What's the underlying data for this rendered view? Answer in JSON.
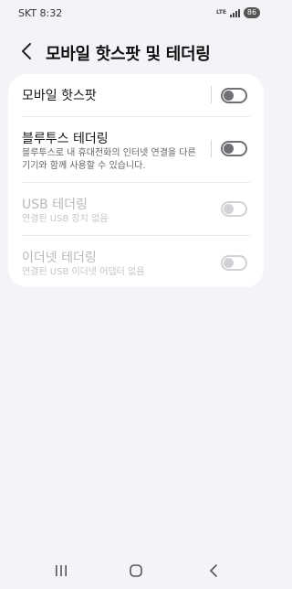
{
  "status": {
    "carrier_time": "SKT 8:32",
    "network": "LTE",
    "battery": "86"
  },
  "header": {
    "title": "모바일 핫스팟 및 테더링",
    "back_icon": "chevron-left-icon"
  },
  "settings": [
    {
      "title": "모바일 핫스팟",
      "subtitle": "",
      "enabled": true,
      "toggle_on": false,
      "split_click": true
    },
    {
      "title": "블루투스 테더링",
      "subtitle": "블루투스로 내 휴대전화의 인터넷 연결을 다른 기기와 함께 사용할 수 있습니다.",
      "enabled": true,
      "toggle_on": false,
      "split_click": true
    },
    {
      "title": "USB 테더링",
      "subtitle": "연결된 USB 장치 없음",
      "enabled": false,
      "toggle_on": false,
      "split_click": false
    },
    {
      "title": "이더넷 테더링",
      "subtitle": "연결된 USB 이더넷 어댑터 없음",
      "enabled": false,
      "toggle_on": false,
      "split_click": false
    }
  ],
  "navbar": {
    "recents_icon": "recent-apps-icon",
    "home_icon": "home-icon",
    "back_icon": "back-icon"
  }
}
